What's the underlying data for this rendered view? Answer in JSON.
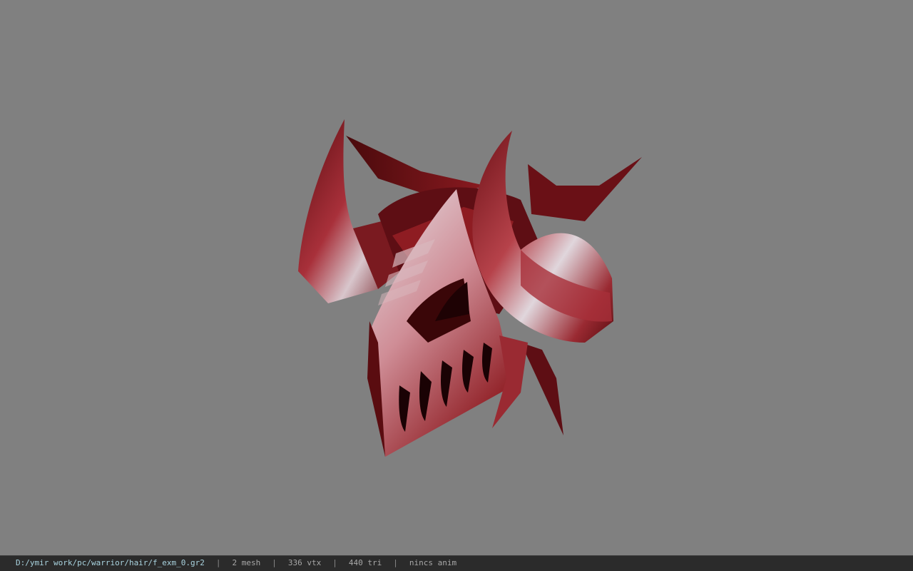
{
  "viewer": {
    "background_color": "#808080",
    "model_icon": "demon-horned-helmet-model",
    "model_colors": {
      "dark_red": "#4a0a0c",
      "mid_red": "#8e1c22",
      "light_red": "#c9454c",
      "highlight": "#e8e0e6"
    }
  },
  "statusbar": {
    "path": "D:/ymir work/pc/warrior/hair/f_exm_0.gr2",
    "mesh": "2 mesh",
    "vtx": "336 vtx",
    "tri": "440 tri",
    "anim": "nincs anim",
    "separator": "|"
  }
}
